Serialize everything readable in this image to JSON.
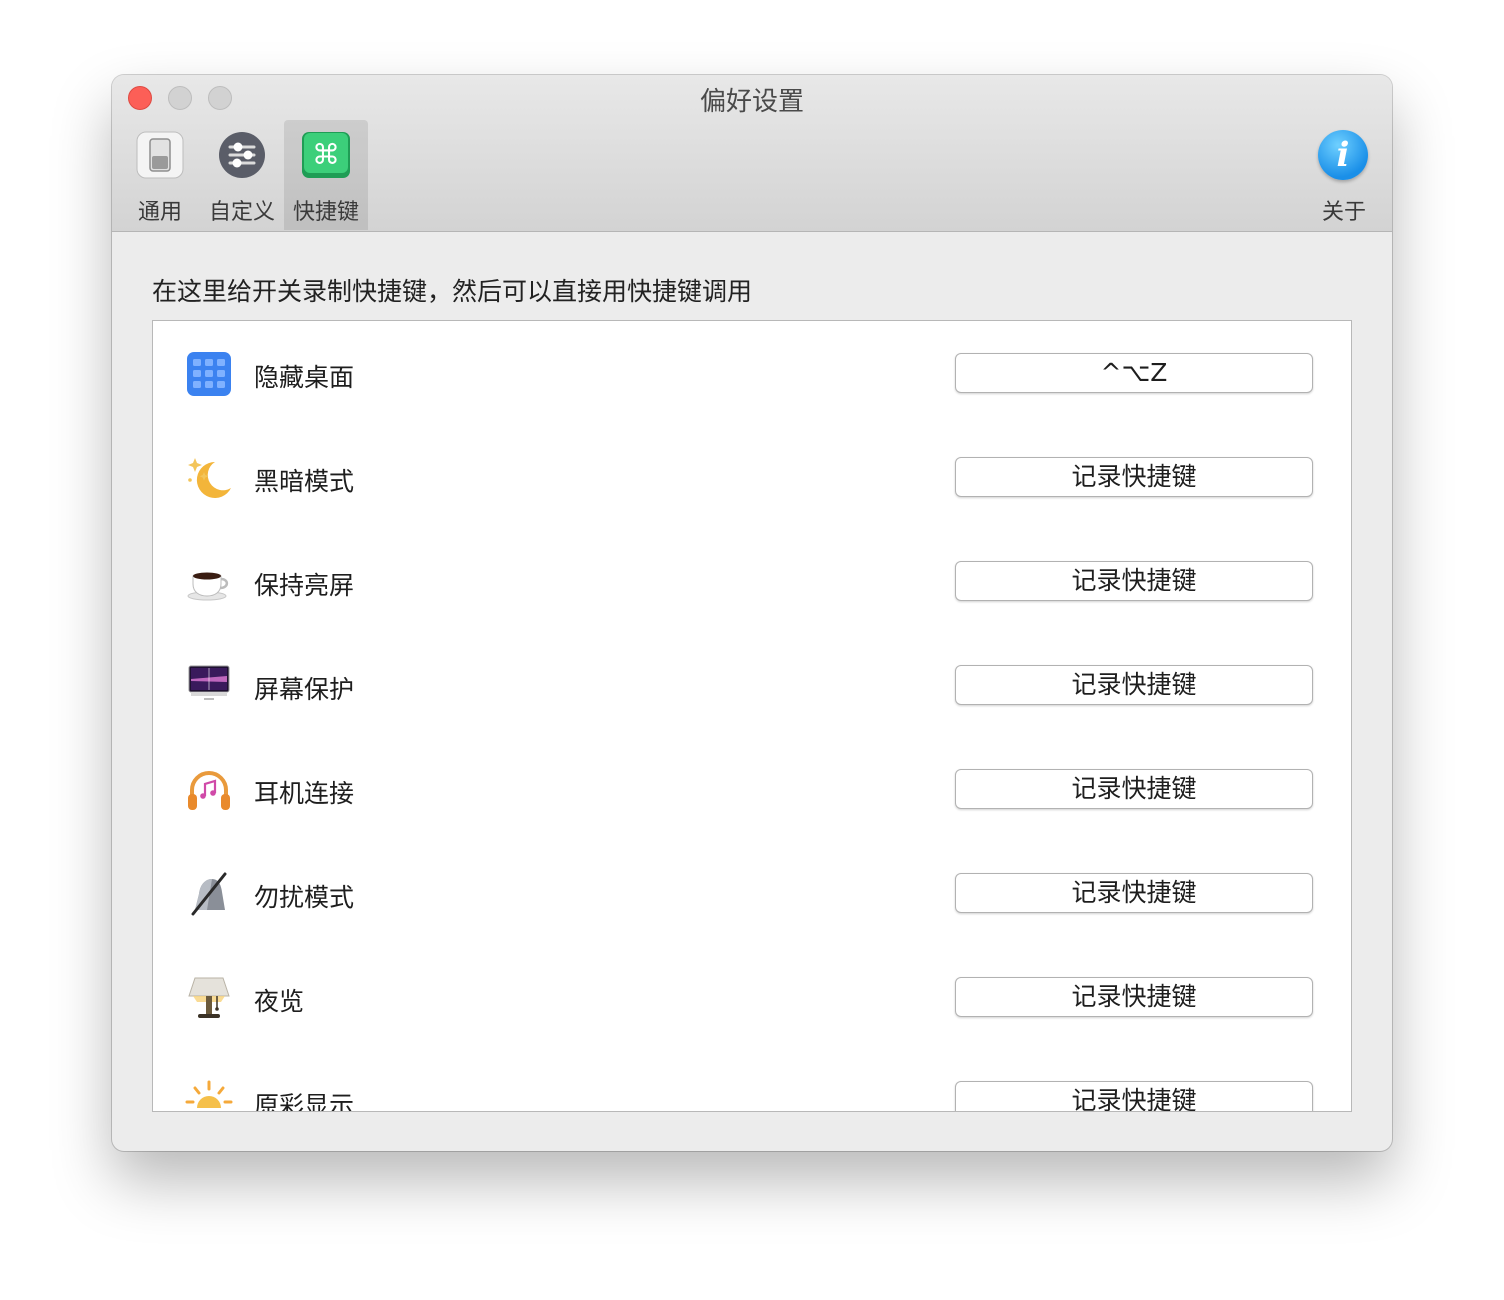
{
  "window": {
    "title": "偏好设置"
  },
  "toolbar": {
    "tabs": [
      {
        "label": "通用",
        "icon": "toggle-switch-icon"
      },
      {
        "label": "自定义",
        "icon": "sliders-icon"
      },
      {
        "label": "快捷键",
        "icon": "command-key-icon",
        "active": true
      }
    ],
    "about_label": "关于",
    "about_icon_glyph": "i"
  },
  "main": {
    "instruction": "在这里给开关录制快捷键，然后可以直接用快捷键调用",
    "items": [
      {
        "label": "隐藏桌面",
        "icon": "grid-desktop-icon",
        "shortcut": "^⌥Z"
      },
      {
        "label": "黑暗模式",
        "icon": "moon-stars-icon",
        "shortcut": "记录快捷键"
      },
      {
        "label": "保持亮屏",
        "icon": "coffee-cup-icon",
        "shortcut": "记录快捷键"
      },
      {
        "label": "屏幕保护",
        "icon": "monitor-icon",
        "shortcut": "记录快捷键"
      },
      {
        "label": "耳机连接",
        "icon": "headphones-icon",
        "shortcut": "记录快捷键"
      },
      {
        "label": "勿扰模式",
        "icon": "muted-bell-icon",
        "shortcut": "记录快捷键"
      },
      {
        "label": "夜览",
        "icon": "lamp-icon",
        "shortcut": "记录快捷键"
      },
      {
        "label": "原彩显示",
        "icon": "sunrise-icon",
        "shortcut": "记录快捷键"
      }
    ]
  },
  "colors": {
    "close": "#fc5f57",
    "command_tab": "#2fbf6b",
    "about": "#1a8fe8"
  }
}
